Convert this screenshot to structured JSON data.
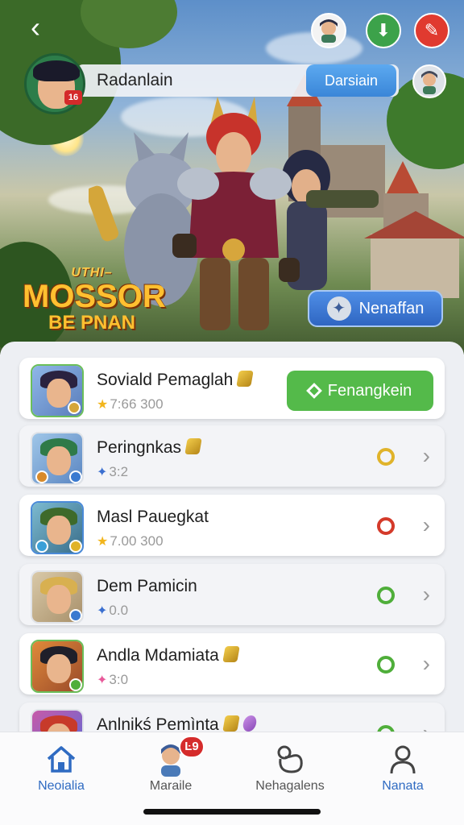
{
  "header": {
    "back_icon": "chevron-left-icon",
    "profile_name": "Radanlain",
    "profile_button": "Darsiain",
    "level_badge": "16"
  },
  "hero": {
    "logo_small": "UTHI–",
    "logo_big": "MOSSOR",
    "logo_sub": "BE PNAN",
    "cta_label": "Nenaffan"
  },
  "list": [
    {
      "title": "Soviald Pemaglah",
      "meta": "7:66 300",
      "meta_icon": "star",
      "action": "Fenangkein",
      "gem": "gold"
    },
    {
      "title": "Peringnkas",
      "meta": "3:2",
      "meta_icon": "star-blue",
      "status_color": "#e0b32a",
      "gem": "gold"
    },
    {
      "title": "Masl Pauegkat",
      "meta": "7.00 300",
      "meta_icon": "star",
      "status_color": "#d43a2a"
    },
    {
      "title": "Dem Pamicin",
      "meta": "0.0",
      "meta_icon": "star-blue",
      "status_color": "#4fae3a"
    },
    {
      "title": "Andla Mdamiata",
      "meta": "3:0",
      "meta_icon": "star-pink",
      "status_color": "#4fae3a",
      "gem": "gold"
    },
    {
      "title": "Anlnikś Pemìnta",
      "meta": "",
      "meta_icon": "",
      "status_color": "#4fae3a",
      "gem": "gold"
    }
  ],
  "tabs": [
    {
      "label": "Neoialia",
      "icon": "home-icon",
      "active": true
    },
    {
      "label": "Maraile",
      "icon": "avatar-icon",
      "badge": "Ŀ9"
    },
    {
      "label": "Nehagalens",
      "icon": "pet-icon"
    },
    {
      "label": "Nanata",
      "icon": "profile-icon",
      "active": true
    }
  ],
  "colors": {
    "accent_blue": "#3a86d8",
    "accent_green": "#54ba4a",
    "badge_red": "#d52b2b"
  }
}
